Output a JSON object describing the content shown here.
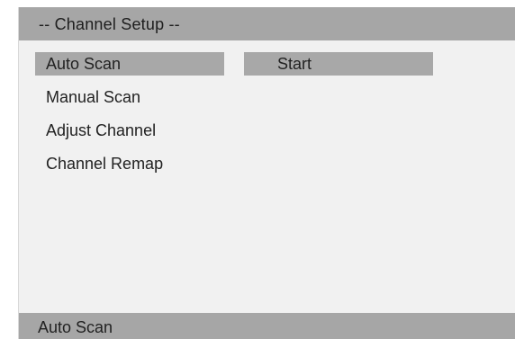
{
  "header": {
    "title": "-- Channel Setup --"
  },
  "menu": {
    "items": [
      {
        "label": "Auto Scan",
        "selected": true
      },
      {
        "label": "Manual Scan",
        "selected": false
      },
      {
        "label": "Adjust Channel",
        "selected": false
      },
      {
        "label": "Channel Remap",
        "selected": false
      }
    ]
  },
  "option": {
    "value": "Start"
  },
  "status": {
    "text": "Auto Scan"
  },
  "colors": {
    "bar": "#a6a6a6",
    "highlight": "#a8a8a8",
    "panel": "#f1f1f1",
    "text": "#222222"
  }
}
